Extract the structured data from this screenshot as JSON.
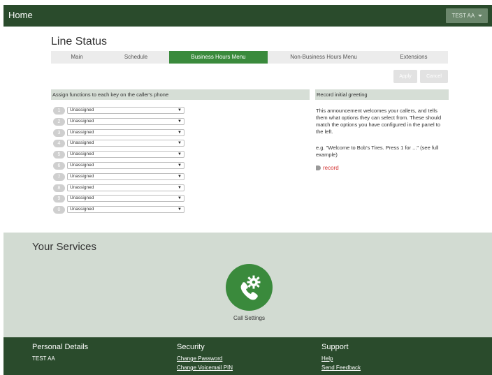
{
  "header": {
    "home": "Home",
    "user": "TEST AA"
  },
  "page_title": "Line Status",
  "tabs": [
    {
      "label": "Main",
      "active": false
    },
    {
      "label": "Schedule",
      "active": false
    },
    {
      "label": "Business Hours Menu",
      "active": true
    },
    {
      "label": "Non-Business Hours Menu",
      "active": false
    },
    {
      "label": "Extensions",
      "active": false
    }
  ],
  "actions": {
    "apply": "Apply",
    "cancel": "Cancel"
  },
  "assign_panel": {
    "title": "Assign functions to each key on the caller's phone",
    "keys": [
      {
        "key": "1",
        "value": "Unassigned"
      },
      {
        "key": "2",
        "value": "Unassigned"
      },
      {
        "key": "3",
        "value": "Unassigned"
      },
      {
        "key": "4",
        "value": "Unassigned"
      },
      {
        "key": "5",
        "value": "Unassigned"
      },
      {
        "key": "6",
        "value": "Unassigned"
      },
      {
        "key": "7",
        "value": "Unassigned"
      },
      {
        "key": "8",
        "value": "Unassigned"
      },
      {
        "key": "9",
        "value": "Unassigned"
      },
      {
        "key": "0",
        "value": "Unassigned"
      }
    ]
  },
  "greeting_panel": {
    "title": "Record initial greeting",
    "description": "This announcement welcomes your callers, and tells them what options they can select from. These should match the options you have configured in the panel to the left.",
    "example": "e.g. \"Welcome to Bob's Tires. Press 1 for ...\" (see full example)",
    "record": "record"
  },
  "services": {
    "title": "Your Services",
    "item_label": "Call Settings"
  },
  "footer": {
    "personal": {
      "heading": "Personal Details",
      "name": "TEST AA"
    },
    "security": {
      "heading": "Security",
      "links": [
        "Change Password",
        "Change Voicemail PIN"
      ]
    },
    "support": {
      "heading": "Support",
      "links": [
        "Help",
        "Send Feedback"
      ]
    }
  },
  "colors": {
    "brand_dark": "#2a4b2c",
    "accent": "#3a8a3c",
    "record": "#d32f2f"
  }
}
